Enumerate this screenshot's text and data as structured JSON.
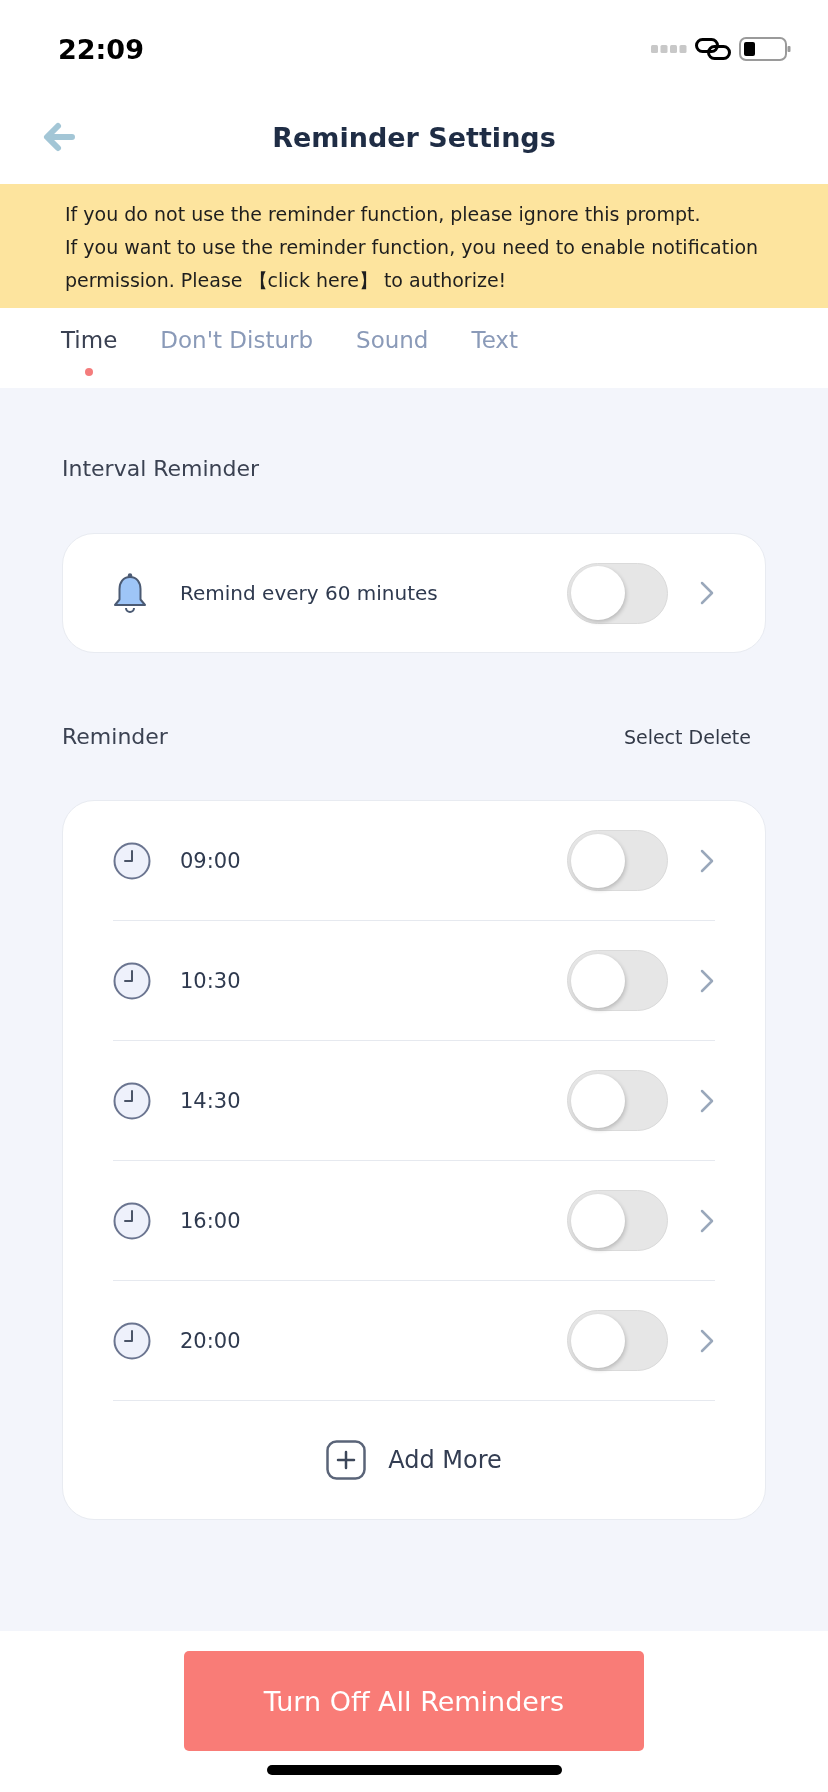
{
  "status_bar": {
    "time": "22:09"
  },
  "header": {
    "title": "Reminder Settings"
  },
  "notice": {
    "text_1": "If you do not use the reminder function, please ignore this prompt.",
    "text_2": {
      "before": "If you want to use the reminder function, you need to enable notification permission. Please",
      "link": "【click here】",
      "after": "to authorize!"
    }
  },
  "tabs": [
    {
      "label": "Time",
      "selected": true
    },
    {
      "label": "Don't Disturb",
      "selected": false
    },
    {
      "label": "Sound",
      "selected": false
    },
    {
      "label": "Text",
      "selected": false
    }
  ],
  "interval_section": {
    "title": "Interval Reminder",
    "item": {
      "label": "Remind every 60 minutes",
      "on": false
    }
  },
  "reminder_section": {
    "title": "Reminder",
    "action": "Select Delete",
    "items": [
      {
        "time": "09:00",
        "on": false
      },
      {
        "time": "10:30",
        "on": false
      },
      {
        "time": "14:30",
        "on": false
      },
      {
        "time": "16:00",
        "on": false
      },
      {
        "time": "20:00",
        "on": false
      }
    ],
    "add_label": "Add More"
  },
  "footer_button": "Turn Off All Reminders"
}
